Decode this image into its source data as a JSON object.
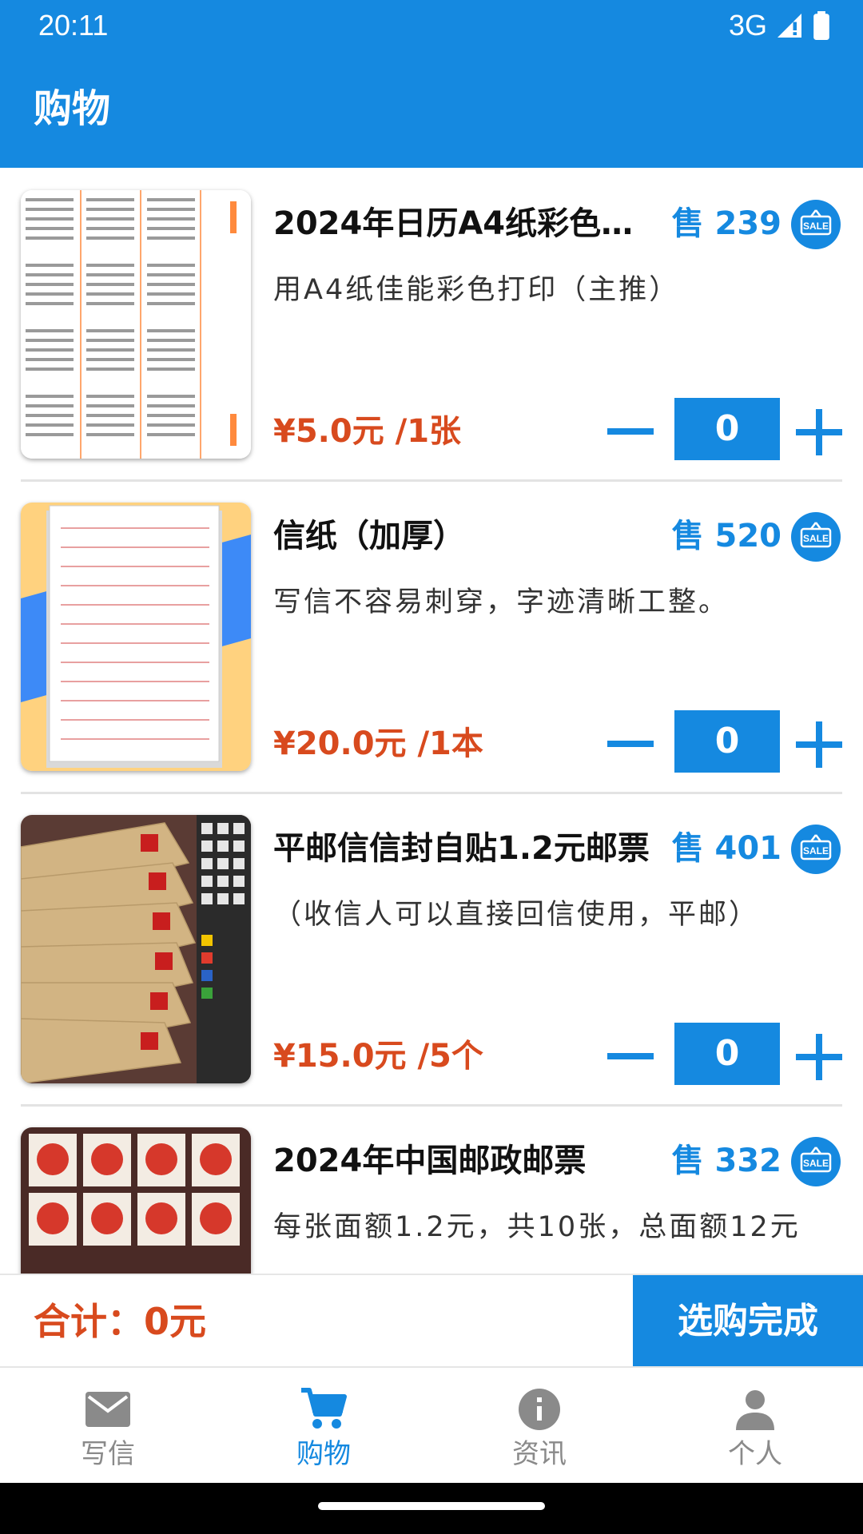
{
  "status_bar": {
    "time": "20:11",
    "network": "3G"
  },
  "app_bar": {
    "title": "购物"
  },
  "products": [
    {
      "title": "2024年日历A4纸彩色打…",
      "sold": "售 239",
      "desc": "用A4纸佳能彩色打印（主推）",
      "price": "¥5.0元 /1张",
      "qty": "0",
      "image": "calendar-image"
    },
    {
      "title": "信纸（加厚）",
      "sold": "售 520",
      "desc": "写信不容易刺穿，字迹清晰工整。",
      "price": "¥20.0元 /1本",
      "qty": "0",
      "image": "letter-paper-image"
    },
    {
      "title": "平邮信信封自贴1.2元邮票",
      "sold": "售 401",
      "desc": "（收信人可以直接回信使用，平邮）",
      "price": "¥15.0元 /5个",
      "qty": "0",
      "image": "envelopes-image"
    },
    {
      "title": "2024年中国邮政邮票",
      "sold": "售 332",
      "desc": "每张面额1.2元，共10张，总面额12元",
      "price": "",
      "qty": "",
      "image": "stamps-image"
    }
  ],
  "cart": {
    "total": "合计：0元",
    "checkout": "选购完成"
  },
  "nav": {
    "items": [
      {
        "label": "写信",
        "icon": "mail-icon"
      },
      {
        "label": "购物",
        "icon": "cart-icon"
      },
      {
        "label": "资讯",
        "icon": "info-icon"
      },
      {
        "label": "个人",
        "icon": "person-icon"
      }
    ],
    "active": "购物"
  },
  "colors": {
    "primary": "#1589e0",
    "price": "#d84a1e",
    "inactive": "#8a8a8a"
  }
}
